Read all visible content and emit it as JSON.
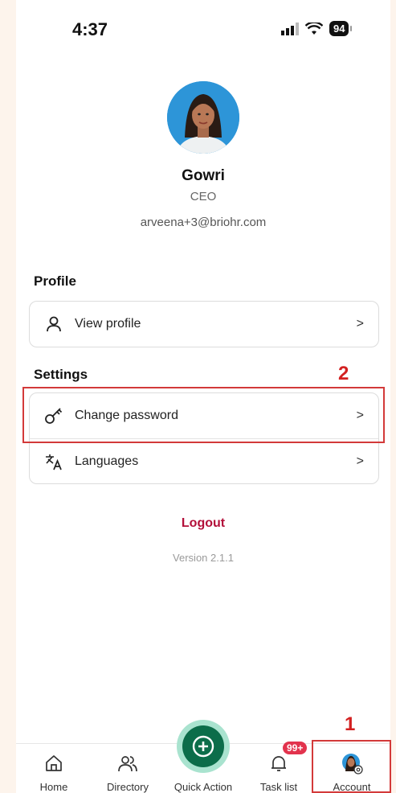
{
  "status_bar": {
    "time": "4:37",
    "battery": "94"
  },
  "profile": {
    "name": "Gowri",
    "role": "CEO",
    "email": "arveena+3@briohr.com"
  },
  "sections": {
    "profile_title": "Profile",
    "view_profile": "View profile",
    "settings_title": "Settings",
    "change_password": "Change password",
    "languages": "Languages"
  },
  "chevron": ">",
  "logout": "Logout",
  "version": "Version 2.1.1",
  "annotations": {
    "one": "1",
    "two": "2"
  },
  "nav": {
    "home": "Home",
    "directory": "Directory",
    "quick_action": "Quick Action",
    "task_list": "Task list",
    "task_badge": "99+",
    "account": "Account"
  },
  "colors": {
    "accent": "#0c6d4a",
    "logout": "#b3103a",
    "badge": "#e2334d",
    "annotation": "#d32020"
  }
}
